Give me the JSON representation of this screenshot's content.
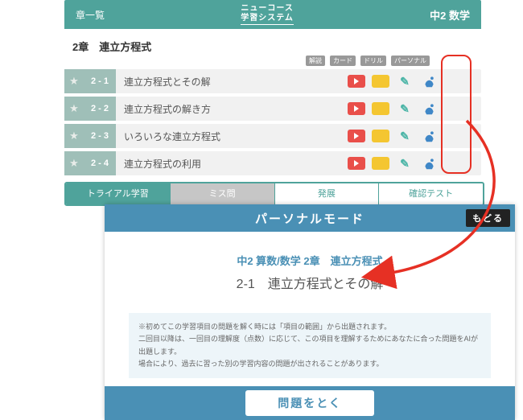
{
  "topbar": {
    "back": "章一覧",
    "logo_line1": "ニューコース",
    "logo_line2": "学習システム",
    "subject": "中2 数学"
  },
  "chapter": {
    "title": "2章　連立方程式"
  },
  "col_heads": [
    "解説",
    "カード",
    "ドリル",
    "パーソナル"
  ],
  "rows": [
    {
      "num": "2 - 1",
      "title": "連立方程式とその解"
    },
    {
      "num": "2 - 2",
      "title": "連立方程式の解き方"
    },
    {
      "num": "2 - 3",
      "title": "いろいろな連立方程式"
    },
    {
      "num": "2 - 4",
      "title": "連立方程式の利用"
    }
  ],
  "tabs": {
    "trial": "トライアル学習",
    "miss": "ミス問",
    "advance": "発展",
    "test": "確認テスト"
  },
  "personal": {
    "header": "パーソナルモード",
    "back": "もどる",
    "crumb": "中2  算数/数学  2章　連立方程式",
    "item_title": "2-1　連立方程式とその解",
    "notice1": "※初めてこの学習項目の問題を解く時には「項目の範囲」から出題されます。",
    "notice2": "二回目以降は、一回目の理解度（点数）に応じて、この項目を理解するためにあなたに合った問題をAIが出題します。",
    "notice3": "場合により、過去に習った別の学習内容の問題が出されることがあります。",
    "solve": "問題をとく"
  }
}
